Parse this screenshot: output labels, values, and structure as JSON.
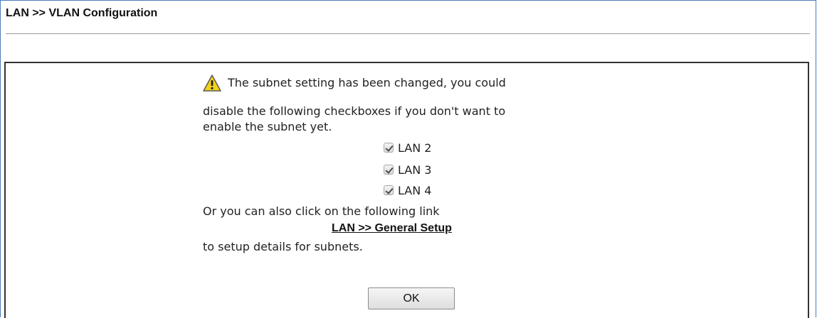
{
  "header": {
    "title": "LAN >> VLAN Configuration"
  },
  "dialog": {
    "warning_icon": "warning-triangle-icon",
    "message_lines": [
      "The subnet setting has been changed, you could",
      "disable the following checkboxes if you don't want to",
      "enable the subnet yet."
    ],
    "checkboxes": [
      {
        "label": "LAN 2",
        "checked": true
      },
      {
        "label": "LAN 3",
        "checked": true
      },
      {
        "label": "LAN 4",
        "checked": true
      }
    ],
    "alt_text": "Or you can also click on the following link",
    "link_label": "LAN >> General Setup",
    "after_link_text": "to setup details for subnets.",
    "ok_label": "OK"
  },
  "colors": {
    "frame_border": "#4a7ebb",
    "dialog_border": "#333333",
    "warning_yellow": "#f2d21a"
  }
}
